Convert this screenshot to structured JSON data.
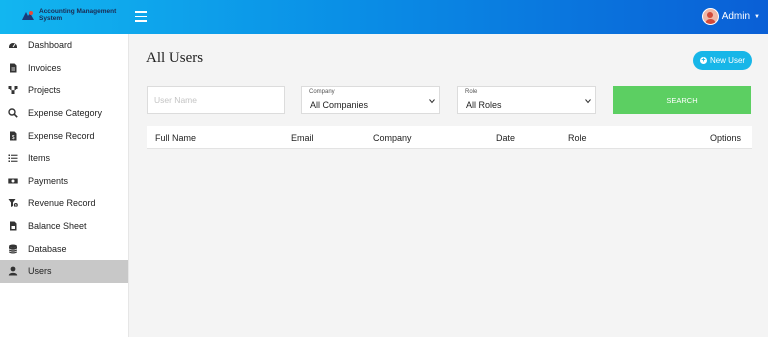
{
  "app": {
    "title_line1": "Accounting Management",
    "title_line2": "System",
    "user_name": "Admin"
  },
  "sidebar": {
    "items": [
      {
        "label": "Dashboard",
        "icon": "dashboard-icon"
      },
      {
        "label": "Invoices",
        "icon": "file-icon"
      },
      {
        "label": "Projects",
        "icon": "sitemap-icon"
      },
      {
        "label": "Expense Category",
        "icon": "search-icon"
      },
      {
        "label": "Expense Record",
        "icon": "file-dollar-icon"
      },
      {
        "label": "Items",
        "icon": "list-icon"
      },
      {
        "label": "Payments",
        "icon": "money-icon"
      },
      {
        "label": "Revenue Record",
        "icon": "filter-dollar-icon"
      },
      {
        "label": "Balance Sheet",
        "icon": "invoice-icon"
      },
      {
        "label": "Database",
        "icon": "database-icon"
      },
      {
        "label": "Users",
        "icon": "user-icon",
        "active": true
      }
    ]
  },
  "page": {
    "title": "All Users",
    "new_user_label": "New User"
  },
  "filters": {
    "username_placeholder": "User Name",
    "company": {
      "caption": "Company",
      "value": "All Companies"
    },
    "role": {
      "caption": "Role",
      "value": "All Roles"
    },
    "search_label": "SEARCH"
  },
  "table": {
    "columns": [
      "Full Name",
      "Email",
      "Company",
      "Date",
      "Role",
      "Options"
    ]
  },
  "colors": {
    "topbar_start": "#12b6f0",
    "topbar_end": "#0a5fd6",
    "accent": "#17b6e8",
    "search_button": "#5ccf62",
    "active_nav": "#c8c8c8"
  }
}
